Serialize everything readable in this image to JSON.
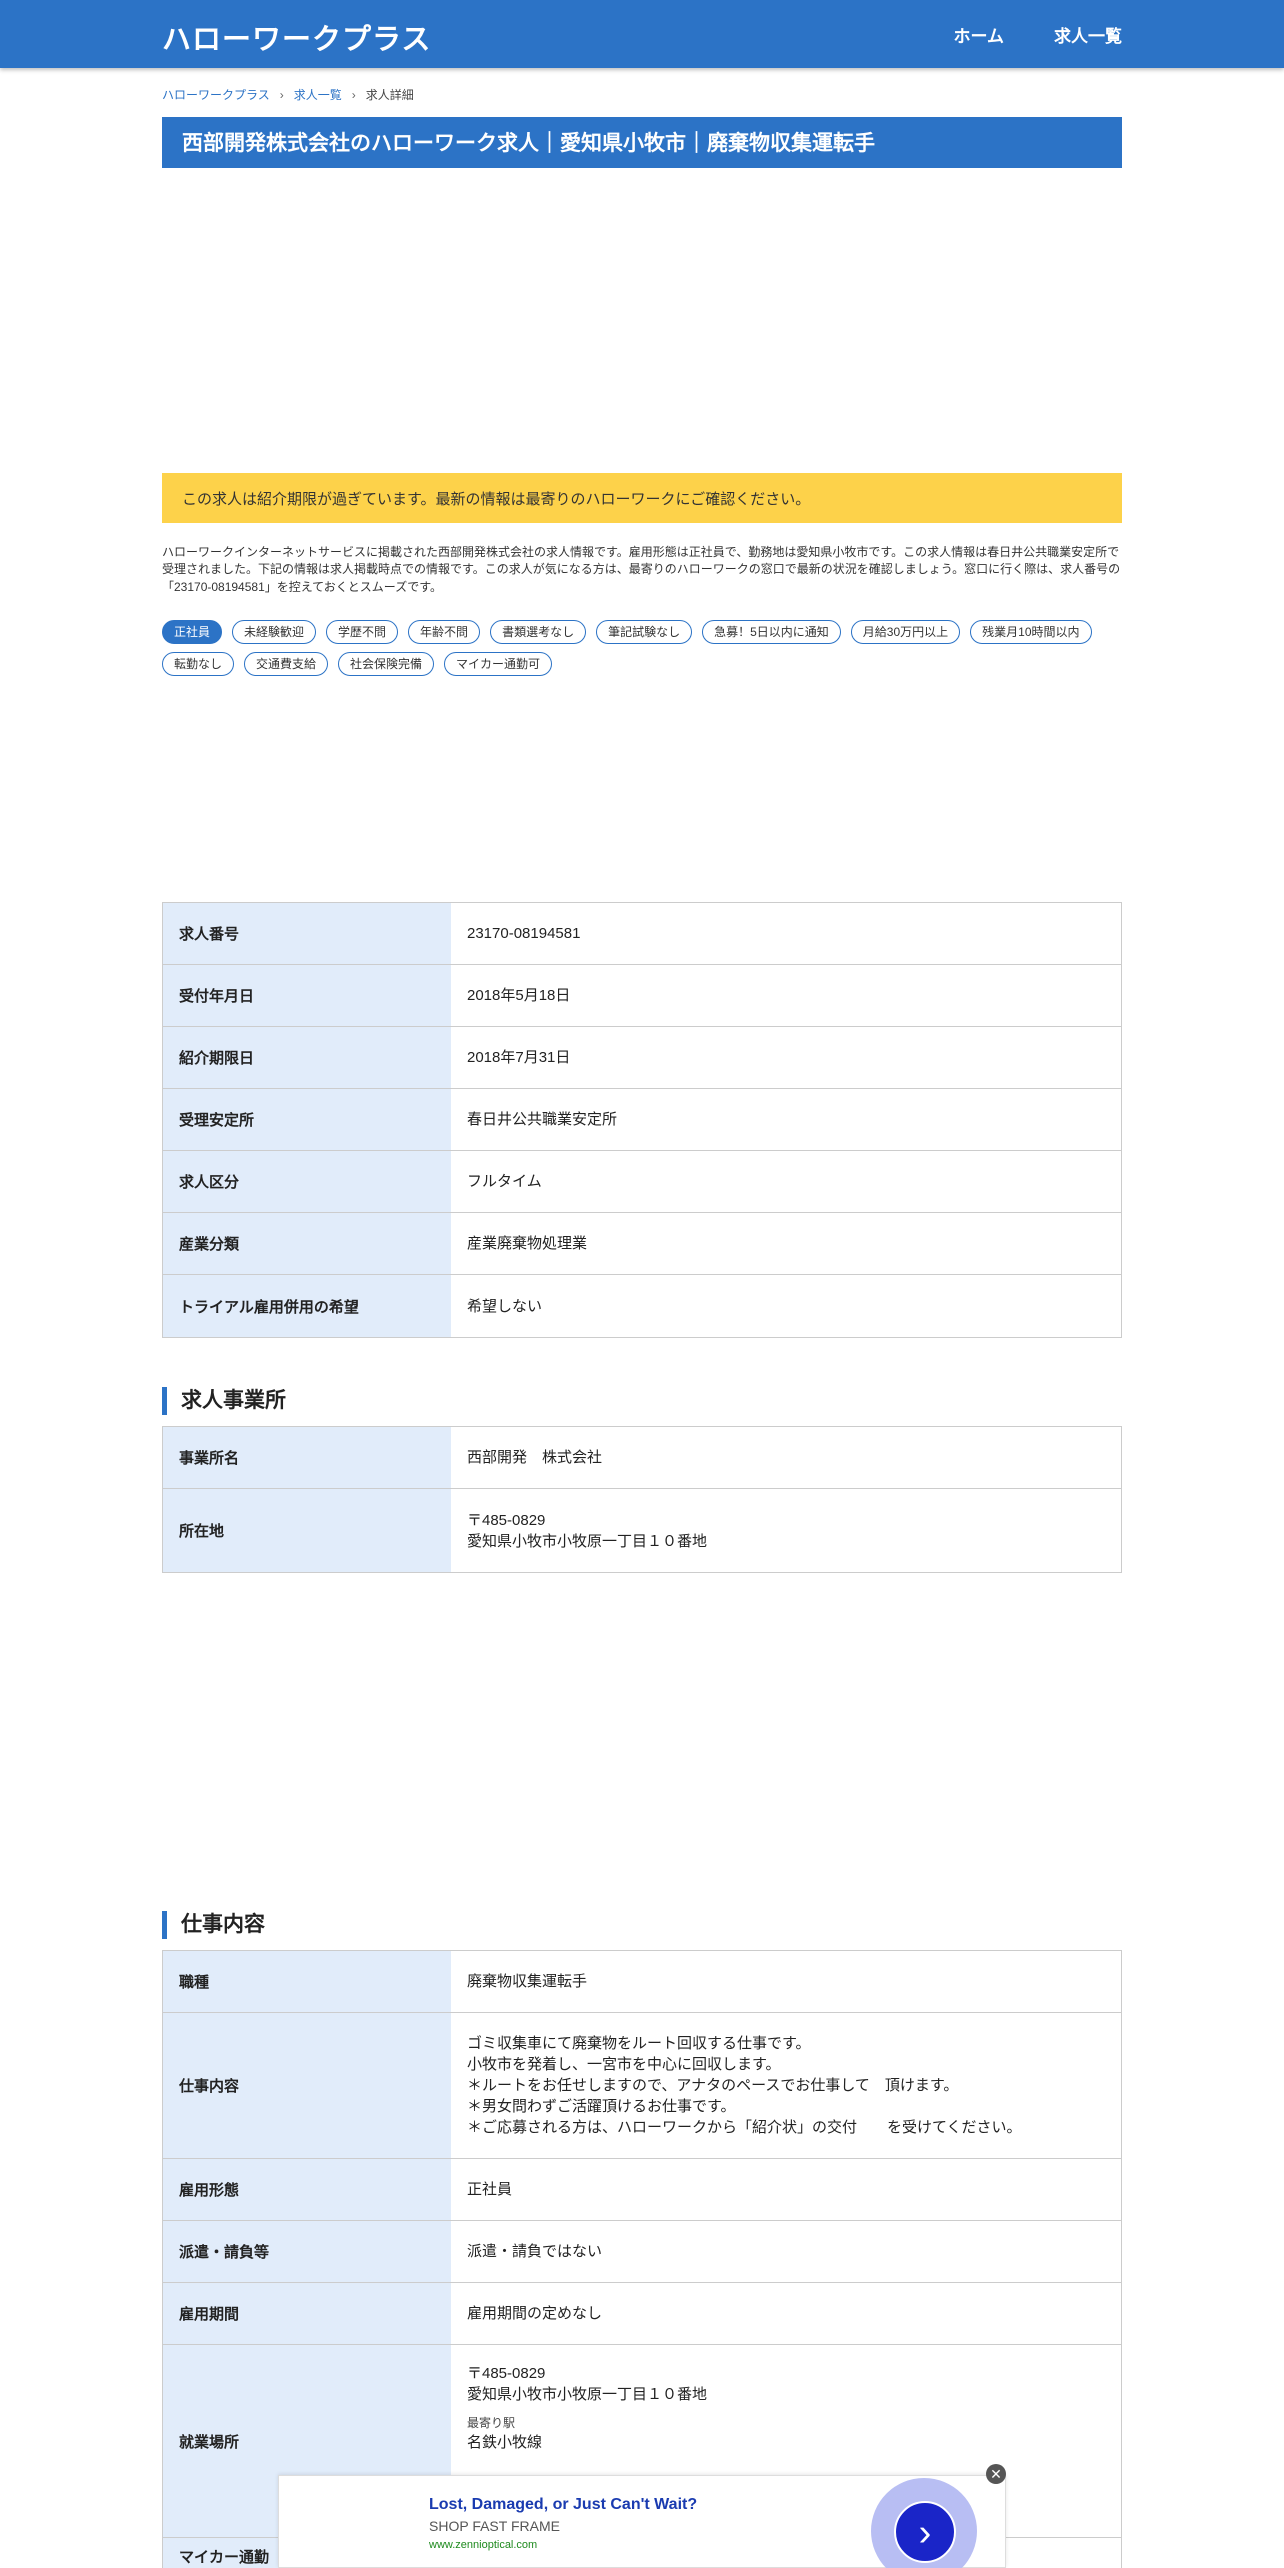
{
  "header": {
    "logo": "ハローワークプラス",
    "nav": [
      "ホーム",
      "求人一覧"
    ]
  },
  "breadcrumb": [
    "ハローワークプラス",
    "求人一覧",
    "求人詳細"
  ],
  "title": "西部開発株式会社のハローワーク求人｜愛知県小牧市｜廃棄物収集運転手",
  "notice": "この求人は紹介期限が過ぎています。最新の情報は最寄りのハローワークにご確認ください。",
  "intro": "ハローワークインターネットサービスに掲載された西部開発株式会社の求人情報です。雇用形態は正社員で、勤務地は愛知県小牧市です。この求人情報は春日井公共職業安定所で受理されました。下記の情報は求人掲載時点での情報です。この求人が気になる方は、最寄りのハローワークの窓口で最新の状況を確認しましょう。窓口に行く際は、求人番号の「23170-08194581」を控えておくとスムーズです。",
  "tags": [
    "正社員",
    "未経験歓迎",
    "学歴不問",
    "年齢不問",
    "書類選考なし",
    "筆記試験なし",
    "急募！5日以内に通知",
    "月給30万円以上",
    "残業月10時間以内",
    "転勤なし",
    "交通費支給",
    "社会保険完備",
    "マイカー通勤可"
  ],
  "basic_info": [
    {
      "label": "求人番号",
      "value": "23170-08194581"
    },
    {
      "label": "受付年月日",
      "value": "2018年5月18日"
    },
    {
      "label": "紹介期限日",
      "value": "2018年7月31日"
    },
    {
      "label": "受理安定所",
      "value": "春日井公共職業安定所"
    },
    {
      "label": "求人区分",
      "value": "フルタイム"
    },
    {
      "label": "産業分類",
      "value": "産業廃棄物処理業"
    },
    {
      "label": "トライアル雇用併用の希望",
      "value": "希望しない"
    }
  ],
  "office_section": {
    "heading": "求人事業所",
    "rows": [
      {
        "label": "事業所名",
        "value": "西部開発　株式会社"
      },
      {
        "label": "所在地",
        "line1": "〒485-0829",
        "line2": "愛知県小牧市小牧原一丁目１０番地"
      }
    ]
  },
  "work_section": {
    "heading": "仕事内容",
    "rows": [
      {
        "label": "職種",
        "value": "廃棄物収集運転手"
      },
      {
        "label": "仕事内容",
        "lines": [
          "ゴミ収集車にて廃棄物をルート回収する仕事です。",
          "小牧市を発着し、一宮市を中心に回収します。",
          "＊ルートをお任せしますので、アナタのペースでお仕事して　頂けます。",
          "＊男女問わずご活躍頂けるお仕事です。",
          "＊ご応募される方は、ハローワークから「紹介状」の交付　　を受けてください。"
        ]
      },
      {
        "label": "雇用形態",
        "value": "正社員"
      },
      {
        "label": "派遣・請負等",
        "value": "派遣・請負ではない"
      },
      {
        "label": "雇用期間",
        "value": "雇用期間の定めなし"
      },
      {
        "label": "就業場所",
        "line1": "〒485-0829",
        "line2": "愛知県小牧市小牧原一丁目１０番地",
        "station_label": "最寄り駅",
        "station": "名鉄小牧線"
      },
      {
        "label": "マイカー通勤"
      }
    ]
  },
  "ad": {
    "title": "Lost, Damaged, or Just Can't Wait?",
    "subtitle": "SHOP FAST FRAME",
    "url": "www.zennioptical.com",
    "close": "✕",
    "arrow": "›"
  }
}
